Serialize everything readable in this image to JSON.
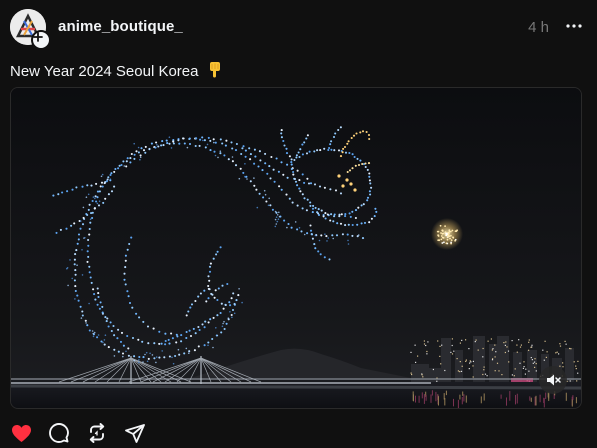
{
  "post": {
    "author": {
      "username": "anime_boutique_",
      "avatar_icon": "anime-logo-avatar",
      "follow_icon": "plus-icon"
    },
    "timestamp": "4 h",
    "more_icon": "more-horizontal-icon",
    "caption": "New Year 2024 Seoul Korea",
    "caption_emoji": "pointing-down-hand-emoji",
    "media": {
      "type": "video",
      "description_icon": "drone-show-dragon",
      "mute_icon": "speaker-muted-icon"
    },
    "actions": [
      {
        "name": "like",
        "icon": "heart-icon",
        "active": true,
        "color": "#ff3040"
      },
      {
        "name": "comment",
        "icon": "comment-icon",
        "active": false
      },
      {
        "name": "repost",
        "icon": "repost-icon",
        "active": false
      },
      {
        "name": "share",
        "icon": "send-icon",
        "active": false
      }
    ]
  },
  "colors": {
    "background": "#101010",
    "text_primary": "#f3f5f7",
    "text_secondary": "#777777",
    "like_red": "#ff3040",
    "drone_blue": "#6fb6ff"
  }
}
